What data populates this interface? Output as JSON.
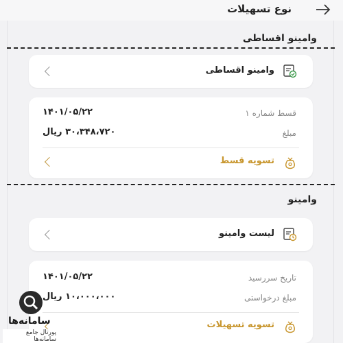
{
  "header": {
    "title": "نوع تسهیلات",
    "back_icon": "arrow-right-icon"
  },
  "section1": {
    "title": "وامینو اقساطی",
    "item": {
      "label": "وامینو اقساطی",
      "icon": "installment-loan-icon"
    },
    "detail": {
      "installment_label": "قسط شماره ۱",
      "date": "۱۴۰۱/۰۵/۲۲",
      "amount_label": "مبلغ",
      "amount": "۳۰،۳۴۸،۷۲۰ ریال",
      "action_label": "تسویه قسط"
    }
  },
  "section2": {
    "title": "وامینو",
    "item": {
      "label": "لیست وامینو",
      "icon": "loan-list-icon"
    },
    "detail": {
      "due_date_label": "تاریخ سررسید",
      "date": "۱۴۰۱/۰۵/۲۲",
      "amount_label": "مبلغ درخواستی",
      "amount": "۱۰،۰۰۰،۰۰۰ ریال",
      "action_label": "تسویه تسهیلات"
    }
  },
  "watermark": {
    "name": "سامانه‌ها",
    "subtitle": "پورتال جامع سامانه‌ها"
  },
  "colors": {
    "accent": "#c8962e",
    "background": "#f2f2f4",
    "card": "#ffffff"
  }
}
